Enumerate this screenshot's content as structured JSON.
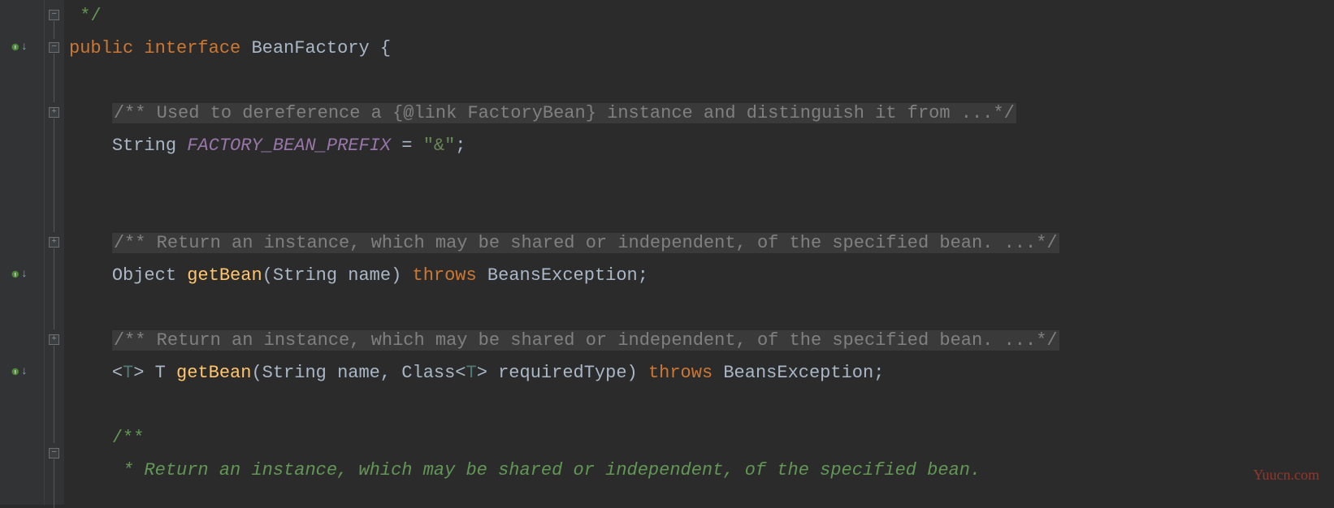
{
  "watermark": "Yuucn.com",
  "gutter": {
    "implements_icon": "I",
    "down_arrow": "↓"
  },
  "fold": {
    "plus": "+",
    "minus": "−"
  },
  "code": {
    "l0_close_comment": " */",
    "l1_public": "public",
    "l1_interface": "interface",
    "l1_name": "BeanFactory",
    "l1_brace": " {",
    "l3_comment": "/** Used to dereference a {@link FactoryBean} instance and distinguish it from ...*/",
    "l4_type": "String ",
    "l4_field": "FACTORY_BEAN_PREFIX",
    "l4_eq": " = ",
    "l4_str": "\"&\"",
    "l4_semi": ";",
    "l7_comment": "/** Return an instance, which may be shared or independent, of the specified bean. ...*/",
    "l8_ret": "Object ",
    "l8_method": "getBean",
    "l8_params": "(String name) ",
    "l8_throws": "throws",
    "l8_exc": " BeansException",
    "l8_semi": ";",
    "l10_comment": "/** Return an instance, which may be shared or independent, of the specified bean. ...*/",
    "l11_gen_open": "<",
    "l11_gen_t1": "T",
    "l11_gen_close": "> ",
    "l11_ret": "T ",
    "l11_method": "getBean",
    "l11_p_open": "(String name, Class<",
    "l11_p_t": "T",
    "l11_p_close": "> requiredType) ",
    "l11_throws": "throws",
    "l11_exc": " BeansException",
    "l11_semi": ";",
    "l13_open": "/**",
    "l14_body": " * Return an instance, which may be shared or independent, of the specified bean."
  }
}
